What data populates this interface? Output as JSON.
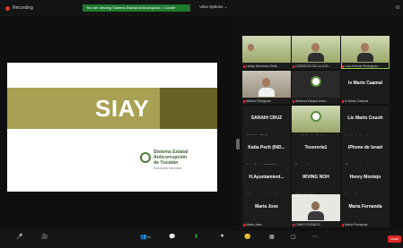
{
  "topbar": {
    "recording": "Recording",
    "share_banner": "You are viewing Sistema Estatal Anticorrupción / Comité",
    "view_options": "View Options ⌄",
    "right_label": "Vi"
  },
  "slide": {
    "title": "SIAY",
    "org_line1": "Sistema Estatal",
    "org_line2": "Anticorrupción",
    "org_line3": "de Yucatán",
    "org_sub": "Secretaría Ejecutiva"
  },
  "participants": [
    {
      "name": "",
      "label": "Laddy Mendoza Sella",
      "kind": "video-green"
    },
    {
      "name": "",
      "label": "CONSEJO DE LA JUD...",
      "kind": "video-person"
    },
    {
      "name": "",
      "label": "Luis Antonio Rodríguez ...",
      "kind": "video-person",
      "active": true
    },
    {
      "name": "",
      "label": "Marisol Cheguaie",
      "kind": "video-person"
    },
    {
      "name": "",
      "label": "Sistema Estatal Antic...",
      "kind": "video-logo"
    },
    {
      "name": "Iv Mario Caamal",
      "label": "Iv Mario Caamal",
      "kind": "name"
    },
    {
      "name": "SARAHI CRUZ",
      "label": "SARAHI CRUZ",
      "kind": "name"
    },
    {
      "name": "",
      "label": "Luz Guillermo Galván...",
      "kind": "video-logo-green"
    },
    {
      "name": "Lic Mario Couoh",
      "label": "Lic Mario Couoh",
      "kind": "name"
    },
    {
      "name": "Katia Pech (IND...",
      "label": "Katia Pech (INDERM)",
      "kind": "name"
    },
    {
      "name": "Tesoreria1",
      "label": "Tesoreria1",
      "kind": "name"
    },
    {
      "name": "iPhone de Israel",
      "label": "iPhone de Israel",
      "kind": "name"
    },
    {
      "name": "H.Ayuntamient...",
      "label": "H.Ayuntamiento de Y...",
      "kind": "name"
    },
    {
      "name": "IRVING NOH",
      "label": "IRVING NOH",
      "kind": "name"
    },
    {
      "name": "Henry Montejo",
      "label": "Henry Montejo",
      "kind": "name"
    },
    {
      "name": "Maria Jose",
      "label": "Maria Jose",
      "kind": "name"
    },
    {
      "name": "",
      "label": "CAMIT ROSADO",
      "kind": "video-person-white"
    },
    {
      "name": "Maria Fernanda",
      "label": "Maria Fernanda",
      "kind": "name"
    }
  ],
  "toolbar": {
    "mic": "🎤",
    "video": "🎥",
    "participants": "👥",
    "participants_count": "31",
    "chat": "💬",
    "share": "⬆",
    "record": "⏺",
    "reactions": "🙂",
    "apps": "▦",
    "whiteboards": "▢",
    "more": "⋯",
    "leave": "Leave"
  }
}
